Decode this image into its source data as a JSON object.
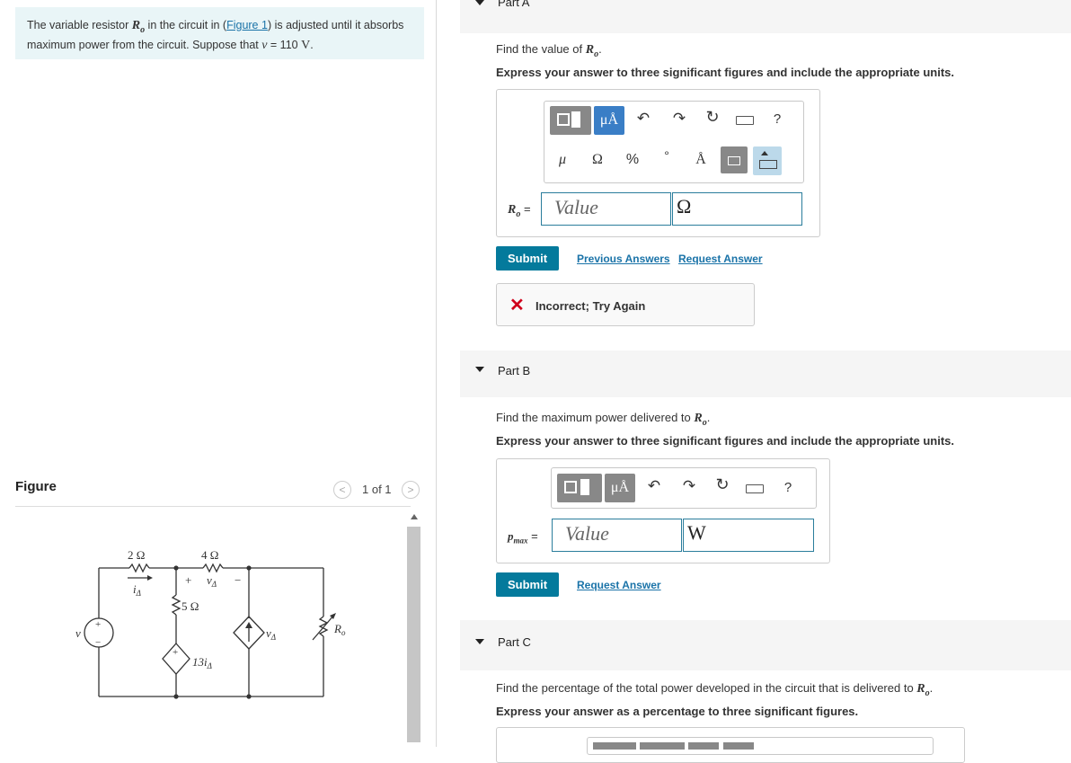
{
  "problem": {
    "text_1": "The variable resistor ",
    "var_R": "R",
    "var_R_sub": "o",
    "text_2": " in the circuit in (",
    "figure_link": "Figure 1",
    "text_3": ") is adjusted until it absorbs maximum power from the circuit. Suppose that ",
    "var_v": "v",
    "text_4": " = 110 ",
    "unit_V": "V",
    "text_5": "."
  },
  "figure": {
    "label": "Figure",
    "pager": "1 of 1",
    "circuit": {
      "r1": "2 Ω",
      "r2": "4 Ω",
      "r3": "5 Ω",
      "i_label": "i",
      "i_sub": "Δ",
      "v_plus": "+",
      "v_label": "v",
      "v_sub": "Δ",
      "v_minus": "−",
      "source_v": "v",
      "dep_src_label": "13i",
      "dep_src_sub": "Δ",
      "cs_label": "v",
      "cs_sub": "Δ",
      "ro_label": "R",
      "ro_sub": "o",
      "plus": "+",
      "minus": "−"
    }
  },
  "parts": {
    "a": {
      "title": "Part A",
      "question_pre": "Find the value of ",
      "q_var": "R",
      "q_sub": "o",
      "q_post": ".",
      "instruction": "Express your answer to three significant figures and include the appropriate units.",
      "input_label": "R",
      "input_sub": "o",
      "input_eq": " =",
      "value_placeholder": "Value",
      "unit": "Ω",
      "submit": "Submit",
      "prev_answers": "Previous Answers",
      "request_answer": "Request Answer",
      "feedback": "Incorrect; Try Again",
      "toolbar": [
        "μ",
        "Ω",
        "%",
        "°",
        "Å"
      ]
    },
    "b": {
      "title": "Part B",
      "question_pre": "Find the maximum power delivered to ",
      "q_var": "R",
      "q_sub": "o",
      "q_post": ".",
      "instruction": "Express your answer to three significant figures and include the appropriate units.",
      "input_label": "p",
      "input_sub": "max",
      "input_eq": " =",
      "value_placeholder": "Value",
      "unit": "W",
      "submit": "Submit",
      "request_answer": "Request Answer"
    },
    "c": {
      "title": "Part C",
      "question_pre": "Find the percentage of the total power developed in the circuit that is delivered to ",
      "q_var": "R",
      "q_sub": "o",
      "q_post": ".",
      "instruction": "Express your answer as a percentage to three significant figures."
    }
  },
  "toolbar": {
    "units_btn": "μÅ",
    "help": "?"
  },
  "colors": {
    "accent": "#047a9c",
    "link": "#1a73a8",
    "error": "#d0021b",
    "problem_bg": "#e9f5f7"
  }
}
